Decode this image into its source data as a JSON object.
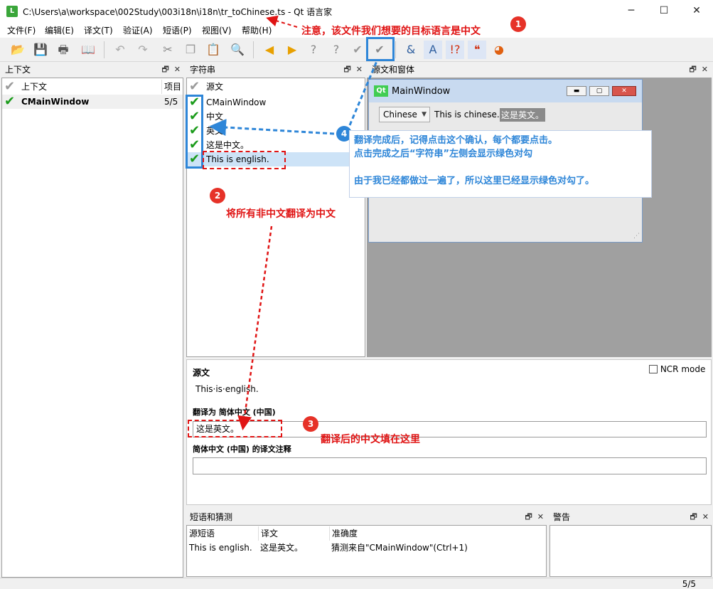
{
  "window": {
    "title": "C:\\Users\\a\\workspace\\002Study\\003i18n\\i18n\\tr_toChinese.ts - Qt 语言家",
    "app_icon_letter": "L",
    "minimize": "─",
    "maximize": "☐",
    "close": "✕"
  },
  "menu": [
    "文件(F)",
    "编辑(E)",
    "译文(T)",
    "验证(A)",
    "短语(P)",
    "视图(V)",
    "帮助(H)"
  ],
  "toolbar_icons": [
    "open-icon",
    "save-icon",
    "print-icon",
    "phrasebook-icon",
    "undo-icon",
    "redo-icon",
    "cut-icon",
    "copy-icon",
    "paste-icon",
    "find-icon",
    "prev-unfinished-icon",
    "next-unfinished-icon",
    "prev-icon",
    "next-icon",
    "done-icon",
    "done-next-icon",
    "accelerator-icon",
    "surrounding-whitespace-icon",
    "punctuation-icon",
    "phrase-match-icon",
    "placemarker-icon"
  ],
  "context_dock": {
    "title": "上下文",
    "col_context": "上下文",
    "col_items": "项目",
    "rows": [
      {
        "name": "CMainWindow",
        "count": "5/5"
      }
    ]
  },
  "strings_dock": {
    "title": "字符串",
    "col_source": "源文",
    "rows": [
      "CMainWindow",
      "中文",
      "英文",
      "这是中文。",
      "This is english."
    ]
  },
  "form_dock": {
    "title": "源文和窗体",
    "preview_title": "MainWindow",
    "qt_logo": "Qt",
    "combo_value": "Chinese",
    "label1": "This is chinese.",
    "label2": "这是英文。"
  },
  "editor": {
    "source_label": "源文",
    "source_text": "This·is·english.",
    "ncr_label": "NCR mode",
    "translate_to_label": "翻译为 简体中文 (中国)",
    "translation_value": "这是英文。",
    "comment_label": "简体中文 (中国) 的译文注释",
    "comment_value": ""
  },
  "phrases_dock": {
    "title": "短语和猜测",
    "col_source": "源短语",
    "col_translation": "译文",
    "col_accuracy": "准确度",
    "rows": [
      {
        "source": "This is english.",
        "translation": "这是英文。",
        "accuracy": "猜测来自\"CMainWindow\"(Ctrl+1)"
      }
    ]
  },
  "warnings_dock": {
    "title": "警告"
  },
  "dock_buttons": {
    "float": "🗗",
    "close": "✕"
  },
  "status": {
    "progress": "5/5"
  },
  "annotations": {
    "a1_text": "注意，该文件我们想要的目标语言是中文",
    "a1_num": "1",
    "a2_text": "将所有非中文翻译为中文",
    "a2_num": "2",
    "a3_text": "翻译后的中文填在这里",
    "a3_num": "3",
    "a4_num": "4",
    "a4_line1": "翻译完成后，记得点击这个确认，每个都要点击。",
    "a4_line2": "点击完成之后“字符串”左侧会显示绿色对勾",
    "a4_line3": "由于我已经都做过一遍了，所以这里已经显示绿色对勾了。"
  }
}
